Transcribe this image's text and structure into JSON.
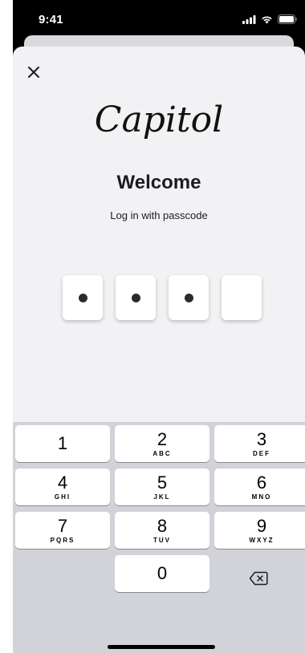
{
  "status_bar": {
    "time": "9:41",
    "icons": [
      "signal-icon",
      "wifi-icon",
      "battery-icon"
    ]
  },
  "header": {
    "close_icon": "close-icon",
    "logo_text": "Capitol",
    "title": "Welcome",
    "subtitle": "Log in with passcode"
  },
  "passcode": {
    "length": 4,
    "filled": 3
  },
  "keypad": {
    "keys": [
      {
        "digit": "1",
        "letters": ""
      },
      {
        "digit": "2",
        "letters": "ABC"
      },
      {
        "digit": "3",
        "letters": "DEF"
      },
      {
        "digit": "4",
        "letters": "GHI"
      },
      {
        "digit": "5",
        "letters": "JKL"
      },
      {
        "digit": "6",
        "letters": "MNO"
      },
      {
        "digit": "7",
        "letters": "PQRS"
      },
      {
        "digit": "8",
        "letters": "TUV"
      },
      {
        "digit": "9",
        "letters": "WXYZ"
      },
      {
        "digit": "0",
        "letters": ""
      }
    ],
    "backspace_icon": "backspace-icon"
  },
  "colors": {
    "sheet_background": "#f2f2f4",
    "keyboard_background": "#d1d3d9",
    "key_background": "#ffffff",
    "text": "#1c1c1e"
  }
}
